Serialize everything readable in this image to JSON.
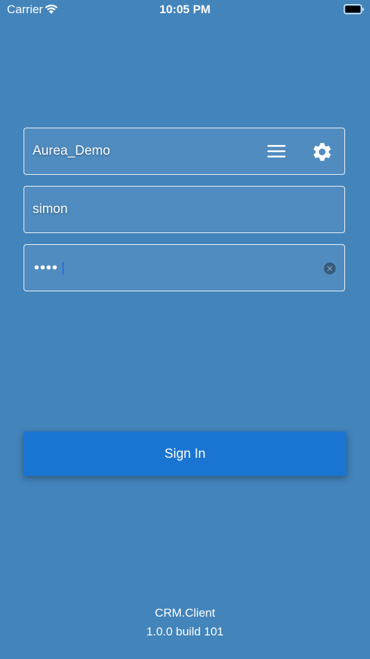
{
  "status_bar": {
    "carrier": "Carrier",
    "time": "10:05 PM",
    "wifi_icon": "wifi-icon",
    "battery_icon": "battery-icon"
  },
  "login": {
    "server": {
      "value": "Aurea_Demo",
      "menu_icon": "menu-icon",
      "settings_icon": "gear-icon"
    },
    "username": {
      "value": "simon"
    },
    "password": {
      "masked_value": "••••",
      "clear_icon": "clear-icon"
    },
    "sign_in_label": "Sign In"
  },
  "footer": {
    "app_name": "CRM.Client",
    "version": "1.0.0 build 101"
  },
  "colors": {
    "background": "#4384bb",
    "button": "#1a75d2",
    "cursor": "#2c6fd6"
  }
}
